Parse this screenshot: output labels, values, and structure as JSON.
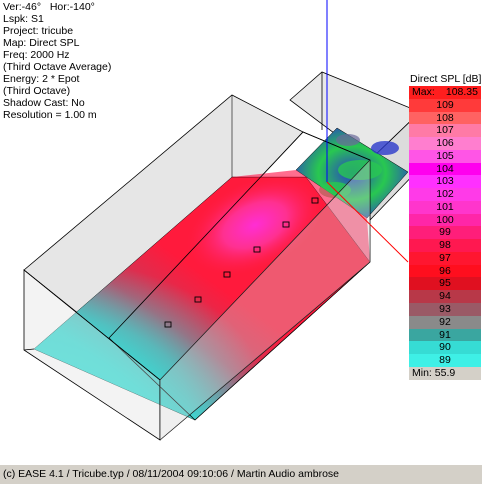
{
  "info": {
    "ver": "Ver:-46°",
    "hor": "Hor:-140°",
    "lspk": "Lspk: S1",
    "project": "Project: tricube",
    "map": "Map: Direct SPL",
    "freq": "Freq: 2000 Hz",
    "average": "(Third Octave Average)",
    "energy": "Energy: 2 * Epot",
    "octave": "(Third Octave)",
    "shadow": "Shadow Cast: No",
    "resolution": "Resolution =  1.00 m"
  },
  "legend": {
    "title": "Direct SPL [dB]",
    "max_label": "Max:",
    "max_value": "108.35",
    "min_label": "Min:",
    "min_value": "55.9",
    "steps": [
      {
        "value": "109",
        "color": "#ff3a3a"
      },
      {
        "value": "108",
        "color": "#ff6262"
      },
      {
        "value": "107",
        "color": "#ff7aa6"
      },
      {
        "value": "106",
        "color": "#ff7ecf"
      },
      {
        "value": "105",
        "color": "#ff55e6"
      },
      {
        "value": "104",
        "color": "#ff00ee"
      },
      {
        "value": "103",
        "color": "#ff30ff"
      },
      {
        "value": "102",
        "color": "#ff3ae8"
      },
      {
        "value": "101",
        "color": "#ff35cc"
      },
      {
        "value": "100",
        "color": "#ff26a8"
      },
      {
        "value": "99",
        "color": "#ff1e7a"
      },
      {
        "value": "98",
        "color": "#ff1850"
      },
      {
        "value": "97",
        "color": "#ff1630"
      },
      {
        "value": "96",
        "color": "#ff0e1e"
      },
      {
        "value": "95",
        "color": "#e01020"
      },
      {
        "value": "94",
        "color": "#b83848"
      },
      {
        "value": "93",
        "color": "#9a5a66"
      },
      {
        "value": "92",
        "color": "#8a8a8a"
      },
      {
        "value": "91",
        "color": "#3aa6a0"
      },
      {
        "value": "90",
        "color": "#36dcd4"
      },
      {
        "value": "89",
        "color": "#3ef0e6"
      }
    ]
  },
  "status_bar": {
    "text": "(c) EASE 4.1  / Tricube.typ  / 08/11/2004 09:10:06 / Martin Audio ambrose"
  },
  "colors": {
    "floor_cyan": "#32e6dc",
    "floor_red": "#ff1a3c",
    "floor_magenta": "#ff2ed4",
    "stage_green": "#28c850",
    "stage_blue": "#2838c8",
    "axis_blue": "#0000ff",
    "axis_red": "#ff0000"
  }
}
